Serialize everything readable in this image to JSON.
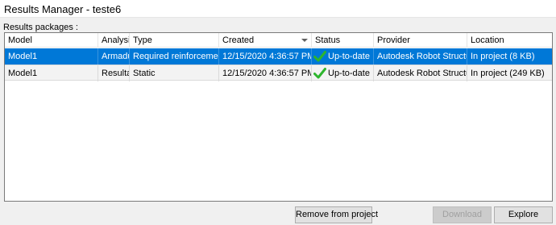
{
  "window": {
    "title": "Results Manager - teste6"
  },
  "section_label": "Results packages :",
  "table": {
    "columns": [
      "Model",
      "Analysis",
      "Type",
      "Created",
      "Status",
      "Provider",
      "Location"
    ],
    "sorted_column": "Created",
    "rows": [
      {
        "model": "Model1",
        "analysis": "Armadura",
        "type": "Required reinforcement",
        "created": "12/15/2020 4:36:57 PM",
        "status": "Up-to-date",
        "provider": "Autodesk Robot Structural Ana",
        "location": "In project (8 KB)",
        "selected": true
      },
      {
        "model": "Model1",
        "analysis": "Resultado",
        "type": "Static",
        "created": "12/15/2020 4:36:57 PM",
        "status": "Up-to-date",
        "provider": "Autodesk Robot Structural Ana",
        "location": "In project (249 KB)",
        "selected": false
      }
    ]
  },
  "buttons": {
    "remove": "Remove from project",
    "download": "Download",
    "explore": "Explore"
  },
  "colors": {
    "selection": "#0078d7",
    "status_ok": "#2db52d"
  },
  "icons": {
    "status": "check-icon"
  }
}
